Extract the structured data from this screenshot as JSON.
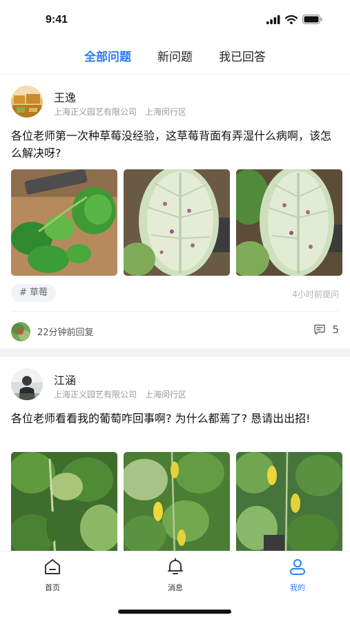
{
  "status_bar": {
    "time": "9:41"
  },
  "tabs": [
    {
      "label": "全部问题",
      "active": true
    },
    {
      "label": "新问题",
      "active": false
    },
    {
      "label": "我已回答",
      "active": false
    }
  ],
  "posts": [
    {
      "user": "王逸",
      "company": "上海正义园艺有限公司",
      "district": "上海闵行区",
      "question": "各位老师第一次种草莓没经验，这草莓背面有弄湿什么病啊，该怎么解决呀?",
      "tag": "# 草莓",
      "asked_time": "4小时前提问",
      "reply_time": "22分钟前回复",
      "comment_count": "5"
    },
    {
      "user": "江涵",
      "company": "上海正义园艺有限公司",
      "district": "上海闵行区",
      "question": "各位老师看看我的葡萄咋回事啊? 为什么都蔫了? 恳请出出招!"
    }
  ],
  "bottom_nav": [
    {
      "label": "首页",
      "icon": "home-icon",
      "active": false
    },
    {
      "label": "消息",
      "icon": "bell-icon",
      "active": false
    },
    {
      "label": "我的",
      "icon": "user-icon",
      "active": true
    }
  ],
  "colors": {
    "accent": "#2e7cf6",
    "page_bg": "#ffffff",
    "section_gap": "#f2f3f5"
  }
}
